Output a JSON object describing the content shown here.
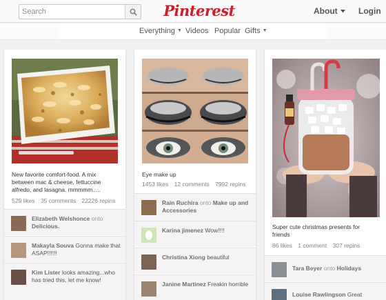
{
  "header": {
    "search_placeholder": "Search",
    "logo": "Pinterest",
    "about": "About",
    "login": "Login",
    "icons": {
      "search": "search-icon",
      "about_caret": "caret-down-icon"
    }
  },
  "subnav": {
    "everything": "Everything",
    "videos": "Videos",
    "popular": "Popular",
    "gifts": "Gifts"
  },
  "pins": [
    {
      "description": "New favorite comfort-food. A mix between mac & cheese, fettuccine alfredo, and lasagna. mmmmm.....",
      "likes": "529 likes",
      "comments": "35 comments",
      "repins": "22226 repins",
      "activity": [
        {
          "user": "Elizabeth Welshonce",
          "onto": "onto",
          "board": "Delicious."
        },
        {
          "user": "Makayla Souva",
          "text": "Gonna make that ASAP!!!!!!"
        },
        {
          "user": "Kim Lister",
          "text": "looks amazing...who has tried this, let me know!"
        }
      ]
    },
    {
      "description": "Eye make up",
      "likes": "1453 likes",
      "comments": "12 comments",
      "repins": "7992 repins",
      "activity": [
        {
          "user": "Rain Ruchira",
          "onto": "onto",
          "board": "Make up and Accessories"
        },
        {
          "user": "Karina jimenez",
          "text": "Wow!!!!"
        },
        {
          "user": "Christina Xiong",
          "text": "beautiful"
        },
        {
          "user": "Janine Martinez",
          "text": "Freakin horrible"
        }
      ]
    },
    {
      "description": "Super cute christmas presents for friends",
      "likes": "86 likes",
      "comments": "1 comment",
      "repins": "307 repins",
      "activity": [
        {
          "user": "Tara Beyer",
          "onto": "onto",
          "board": "Holidays"
        },
        {
          "user": "Louise Rawlingson",
          "text": "Great"
        }
      ]
    }
  ],
  "colors": {
    "brand": "#cb2027",
    "background": "#f2f0f0"
  }
}
